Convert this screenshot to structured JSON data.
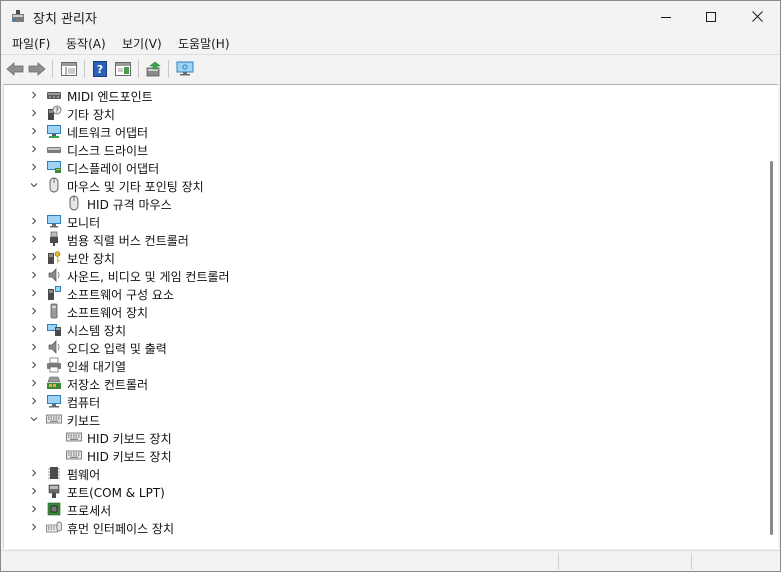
{
  "window": {
    "title": "장치 관리자",
    "icon": "device-manager-icon",
    "controls": [
      "minimize-icon",
      "maximize-icon",
      "close-icon"
    ]
  },
  "menu": {
    "file": "파일(F)",
    "action": "동작(A)",
    "view": "보기(V)",
    "help": "도움말(H)"
  },
  "toolbar": {
    "buttons": [
      "back-arrow-icon",
      "forward-arrow-icon",
      "properties-pane-icon",
      "help-icon",
      "show-hide-pane-icon",
      "update-driver-icon",
      "monitor-scan-icon"
    ]
  },
  "tree": {
    "items": [
      {
        "label": "MIDI 엔드포인트",
        "level": 0,
        "state": "collapsed",
        "icon": "midi-device-icon"
      },
      {
        "label": "기타 장치",
        "level": 0,
        "state": "collapsed",
        "icon": "unknown-device-icon"
      },
      {
        "label": "네트워크 어댑터",
        "level": 0,
        "state": "collapsed",
        "icon": "network-adapter-icon"
      },
      {
        "label": "디스크 드라이브",
        "level": 0,
        "state": "collapsed",
        "icon": "disk-drive-icon"
      },
      {
        "label": "디스플레이 어댑터",
        "level": 0,
        "state": "collapsed",
        "icon": "display-adapter-icon"
      },
      {
        "label": "마우스 및 기타 포인팅 장치",
        "level": 0,
        "state": "expanded",
        "icon": "mouse-icon"
      },
      {
        "label": "HID 규격 마우스",
        "level": 1,
        "state": "leaf",
        "icon": "mouse-icon"
      },
      {
        "label": "모니터",
        "level": 0,
        "state": "collapsed",
        "icon": "monitor-icon"
      },
      {
        "label": "범용 직렬 버스 컨트롤러",
        "level": 0,
        "state": "collapsed",
        "icon": "usb-icon"
      },
      {
        "label": "보안 장치",
        "level": 0,
        "state": "collapsed",
        "icon": "security-key-icon"
      },
      {
        "label": "사운드, 비디오 및 게임 컨트롤러",
        "level": 0,
        "state": "collapsed",
        "icon": "speaker-icon"
      },
      {
        "label": "소프트웨어 구성 요소",
        "level": 0,
        "state": "collapsed",
        "icon": "software-component-icon"
      },
      {
        "label": "소프트웨어 장치",
        "level": 0,
        "state": "collapsed",
        "icon": "software-device-icon"
      },
      {
        "label": "시스템 장치",
        "level": 0,
        "state": "collapsed",
        "icon": "system-device-icon"
      },
      {
        "label": "오디오 입력 및 출력",
        "level": 0,
        "state": "collapsed",
        "icon": "speaker-icon"
      },
      {
        "label": "인쇄 대기열",
        "level": 0,
        "state": "collapsed",
        "icon": "printer-icon"
      },
      {
        "label": "저장소 컨트롤러",
        "level": 0,
        "state": "collapsed",
        "icon": "storage-controller-icon"
      },
      {
        "label": "컴퓨터",
        "level": 0,
        "state": "collapsed",
        "icon": "computer-icon"
      },
      {
        "label": "키보드",
        "level": 0,
        "state": "expanded",
        "icon": "keyboard-icon"
      },
      {
        "label": "HID 키보드 장치",
        "level": 1,
        "state": "leaf",
        "icon": "keyboard-icon"
      },
      {
        "label": "HID 키보드 장치",
        "level": 1,
        "state": "leaf",
        "icon": "keyboard-icon"
      },
      {
        "label": "펌웨어",
        "level": 0,
        "state": "collapsed",
        "icon": "firmware-chip-icon"
      },
      {
        "label": "포트(COM & LPT)",
        "level": 0,
        "state": "collapsed",
        "icon": "port-icon"
      },
      {
        "label": "프로세서",
        "level": 0,
        "state": "collapsed",
        "icon": "processor-icon"
      },
      {
        "label": "휴먼 인터페이스 장치",
        "level": 0,
        "state": "collapsed",
        "icon": "hid-icon"
      }
    ]
  },
  "colors": {
    "window_bg": "#f3f3f3",
    "tree_bg": "#ffffff",
    "text": "#111111",
    "icon_blue": "#2f7fc4",
    "icon_gray": "#6d6d6d"
  }
}
